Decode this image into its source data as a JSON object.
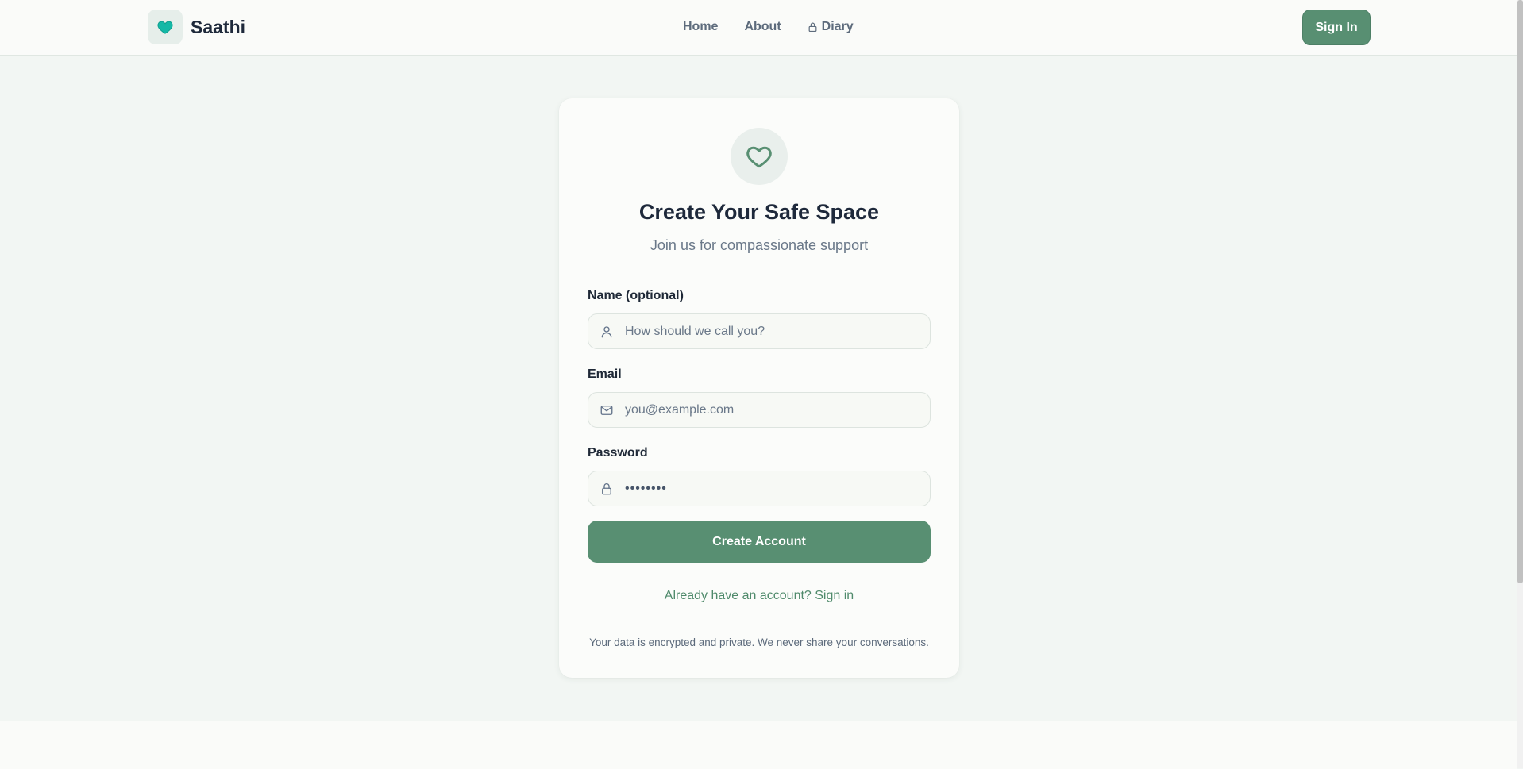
{
  "navbar": {
    "brand_name": "Saathi",
    "brand_icon": "heart-icon",
    "links": [
      {
        "label": "Home"
      },
      {
        "label": "About"
      },
      {
        "label": "Diary",
        "icon": "lock-icon"
      }
    ],
    "sign_in_label": "Sign In"
  },
  "card": {
    "icon": "heart-outline-icon",
    "title": "Create Your Safe Space",
    "subtitle": "Join us for compassionate support",
    "fields": {
      "name": {
        "label": "Name (optional)",
        "placeholder": "How should we call you?",
        "icon": "user-icon"
      },
      "email": {
        "label": "Email",
        "placeholder": "you@example.com",
        "icon": "mail-icon"
      },
      "password": {
        "label": "Password",
        "value": "••••••••",
        "icon": "lock-icon"
      }
    },
    "submit_label": "Create Account",
    "signin_prompt": "Already have an account? Sign in",
    "privacy_note": "Your data is encrypted and private. We never share your conversations."
  },
  "colors": {
    "accent": "#588f72",
    "brand_heart": "#14b8a6",
    "page_background": "#f2f6f3",
    "card_background": "#fbfcfa"
  }
}
